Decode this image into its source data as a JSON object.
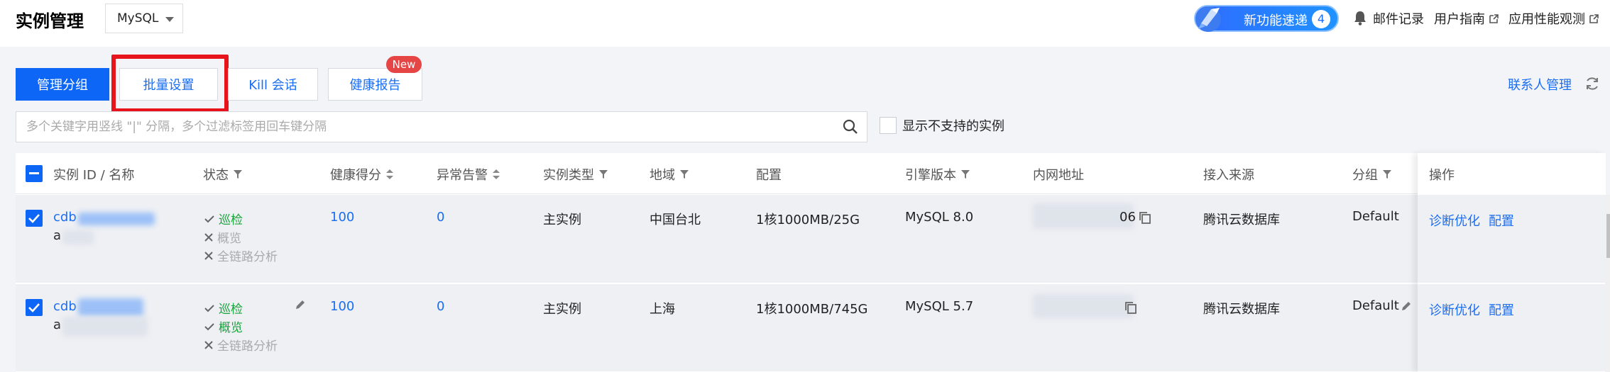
{
  "header": {
    "title": "实例管理",
    "db_type": "MySQL",
    "new_feature_label": "新功能速递",
    "new_feature_count": "4",
    "links": [
      "邮件记录",
      "用户指南",
      "应用性能观测"
    ]
  },
  "toolbar": {
    "tabs": [
      "管理分组",
      "批量设置",
      "Kill 会话",
      "健康报告"
    ],
    "new_badge": "New",
    "contact_link": "联系人管理"
  },
  "search": {
    "placeholder": "多个关键字用竖线 \"|\" 分隔，多个过滤标签用回车键分隔",
    "show_unsupported_label": "显示不支持的实例"
  },
  "table": {
    "columns": [
      "实例 ID / 名称",
      "状态",
      "健康得分",
      "异常告警",
      "实例类型",
      "地域",
      "配置",
      "引擎版本",
      "内网地址",
      "接入来源",
      "分组",
      "操作"
    ],
    "rows": [
      {
        "id_prefix": "cdb",
        "name_prefix": "a",
        "status": [
          {
            "label": "巡检",
            "state": "on"
          },
          {
            "label": "概览",
            "state": "off"
          },
          {
            "label": "全链路分析",
            "state": "off"
          }
        ],
        "health_score": "100",
        "alerts": "0",
        "instance_type": "主实例",
        "region": "中国台北",
        "config": "1核1000MB/25G",
        "engine": "MySQL 8.0",
        "ip_suffix": "06",
        "source": "腾讯云数据库",
        "group": "Default",
        "actions": [
          "诊断优化",
          "配置"
        ]
      },
      {
        "id_prefix": "cdb",
        "name_prefix": "a",
        "status": [
          {
            "label": "巡检",
            "state": "on"
          },
          {
            "label": "概览",
            "state": "on"
          },
          {
            "label": "全链路分析",
            "state": "off"
          }
        ],
        "health_score": "100",
        "alerts": "0",
        "instance_type": "主实例",
        "region": "上海",
        "config": "1核1000MB/745G",
        "engine": "MySQL 5.7",
        "ip_suffix": "",
        "source": "腾讯云数据库",
        "group": "Default",
        "actions": [
          "诊断优化",
          "配置"
        ]
      }
    ]
  },
  "colors": {
    "primary": "#0d66f5",
    "link": "#1a6ef2",
    "highlight_box": "#e8141c",
    "ok_green": "#1aa33b",
    "badge_red": "#e54545"
  },
  "icons": [
    "chevron-down-icon",
    "rocket-icon",
    "bell-icon",
    "external-link-icon",
    "refresh-icon",
    "search-icon",
    "filter-icon",
    "sort-icon",
    "check-icon",
    "close-icon",
    "copy-icon",
    "edit-icon"
  ]
}
